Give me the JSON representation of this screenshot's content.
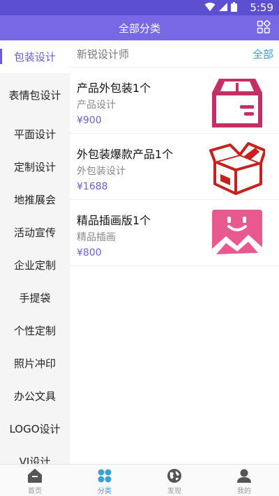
{
  "status": {
    "time": "5:59"
  },
  "header": {
    "title": "全部分类",
    "grid_icon": "grid-icon"
  },
  "sidebar": {
    "items": [
      {
        "label": "包装设计",
        "active": true
      },
      {
        "label": "表情包设计",
        "active": false
      },
      {
        "label": "平面设计",
        "active": false
      },
      {
        "label": "定制设计",
        "active": false
      },
      {
        "label": "地推展会",
        "active": false
      },
      {
        "label": "活动宣传",
        "active": false
      },
      {
        "label": "企业定制",
        "active": false
      },
      {
        "label": "手提袋",
        "active": false
      },
      {
        "label": "个性定制",
        "active": false
      },
      {
        "label": "照片冲印",
        "active": false
      },
      {
        "label": "办公文具",
        "active": false
      },
      {
        "label": "LOGO设计",
        "active": false
      },
      {
        "label": "VI设计",
        "active": false
      }
    ]
  },
  "main": {
    "shop_name": "新锐设计师",
    "all_label": "全部",
    "products": [
      {
        "name": "产品外包装1个",
        "category": "产品设计",
        "price": "¥900",
        "icon": "box-icon"
      },
      {
        "name": "外包装爆款产品1个",
        "category": "外包装设计",
        "price": "¥1688",
        "icon": "open-box-icon"
      },
      {
        "name": "精品插画版1个",
        "category": "精品插画",
        "price": "¥800",
        "icon": "smiley-picture-icon"
      }
    ]
  },
  "tabbar": {
    "tabs": [
      {
        "label": "首页",
        "icon": "home-icon"
      },
      {
        "label": "分类",
        "icon": "category-icon"
      },
      {
        "label": "发现",
        "icon": "globe-icon"
      },
      {
        "label": "我的",
        "icon": "user-icon"
      }
    ]
  },
  "colors": {
    "brand": "#7868e6",
    "accent": "#3aa0d8",
    "product_icon": "#c62f66"
  }
}
